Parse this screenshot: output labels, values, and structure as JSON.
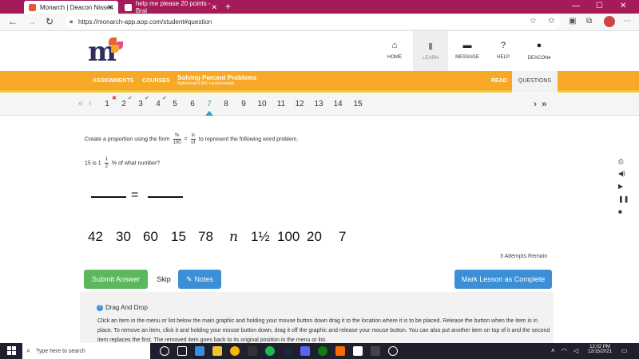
{
  "browser": {
    "tabs": [
      {
        "title": "Monarch | Deacon Nissen",
        "active": true
      },
      {
        "title": "help me please 20 points - Brai",
        "active": false
      }
    ],
    "new_tab": "+",
    "url": "https://monarch-app.aop.com/student#question",
    "window_controls": [
      "—",
      "☐",
      "✕"
    ]
  },
  "header": {
    "logo": "m",
    "nav": [
      {
        "label": "HOME",
        "icon": "home-icon",
        "glyph": "⌂"
      },
      {
        "label": "LEARN",
        "icon": "book-icon",
        "glyph": "▮"
      },
      {
        "label": "MESSAGE",
        "icon": "message-icon",
        "glyph": "▬"
      },
      {
        "label": "HELP",
        "icon": "help-icon",
        "glyph": "?"
      },
      {
        "label": "DEACON",
        "icon": "user-icon",
        "glyph": "●"
      }
    ]
  },
  "subnav": {
    "assignments": "ASSIGNMENTS",
    "courses": "COURSES",
    "lesson_title": "Solving Percent Problems",
    "course_name": "Mathematics 800 Fundamentals",
    "read": "READ",
    "questions": "QUESTIONS"
  },
  "questions": {
    "numbers": [
      "1",
      "2",
      "3",
      "4",
      "5",
      "6",
      "7",
      "8",
      "9",
      "10",
      "11",
      "12",
      "13",
      "14",
      "15"
    ],
    "current": "7",
    "marks": {
      "1": "✖",
      "2": "✔",
      "3": "✔",
      "4": "✔"
    }
  },
  "question": {
    "instruction_pre": "Create a proportion using the form",
    "frac1_num": "%",
    "frac1_den": "100",
    "equals": "=",
    "frac2_num": "is",
    "frac2_den": "of",
    "instruction_post": "to represent the following word problem.",
    "problem_pre": "15 is 1",
    "problem_frac_num": "1",
    "problem_frac_den": "2",
    "problem_post": "% of what number?",
    "equation_equals": "=",
    "tiles": [
      "42",
      "30",
      "60",
      "15",
      "78",
      "n",
      "1½",
      "100",
      "20",
      "7"
    ],
    "attempts": "3 Attempts Remain"
  },
  "buttons": {
    "submit": "Submit Answer",
    "skip": "Skip",
    "notes": "Notes",
    "complete": "Mark Lesson as Complete"
  },
  "help": {
    "title": "Drag And Drop",
    "body": "Click an item in the menu or list below the main graphic and holding your mouse button down drag it to the location where it is to be placed. Release the button when the item is in place. To remove an item, click it and holding your mouse button down, drag it off the graphic and release your mouse button. You can also put another item on top of it and the second item replaces the first. The removed item goes back to its original position in the menu or list."
  },
  "taskbar": {
    "search_placeholder": "Type here to search",
    "time": "12:02 PM",
    "date": "12/15/2021"
  },
  "colors": {
    "tabstrip": "#a51a58",
    "orange": "#f6a826",
    "green": "#5cb85c",
    "blue": "#3a8fd6",
    "accent": "#2aa0c6"
  }
}
